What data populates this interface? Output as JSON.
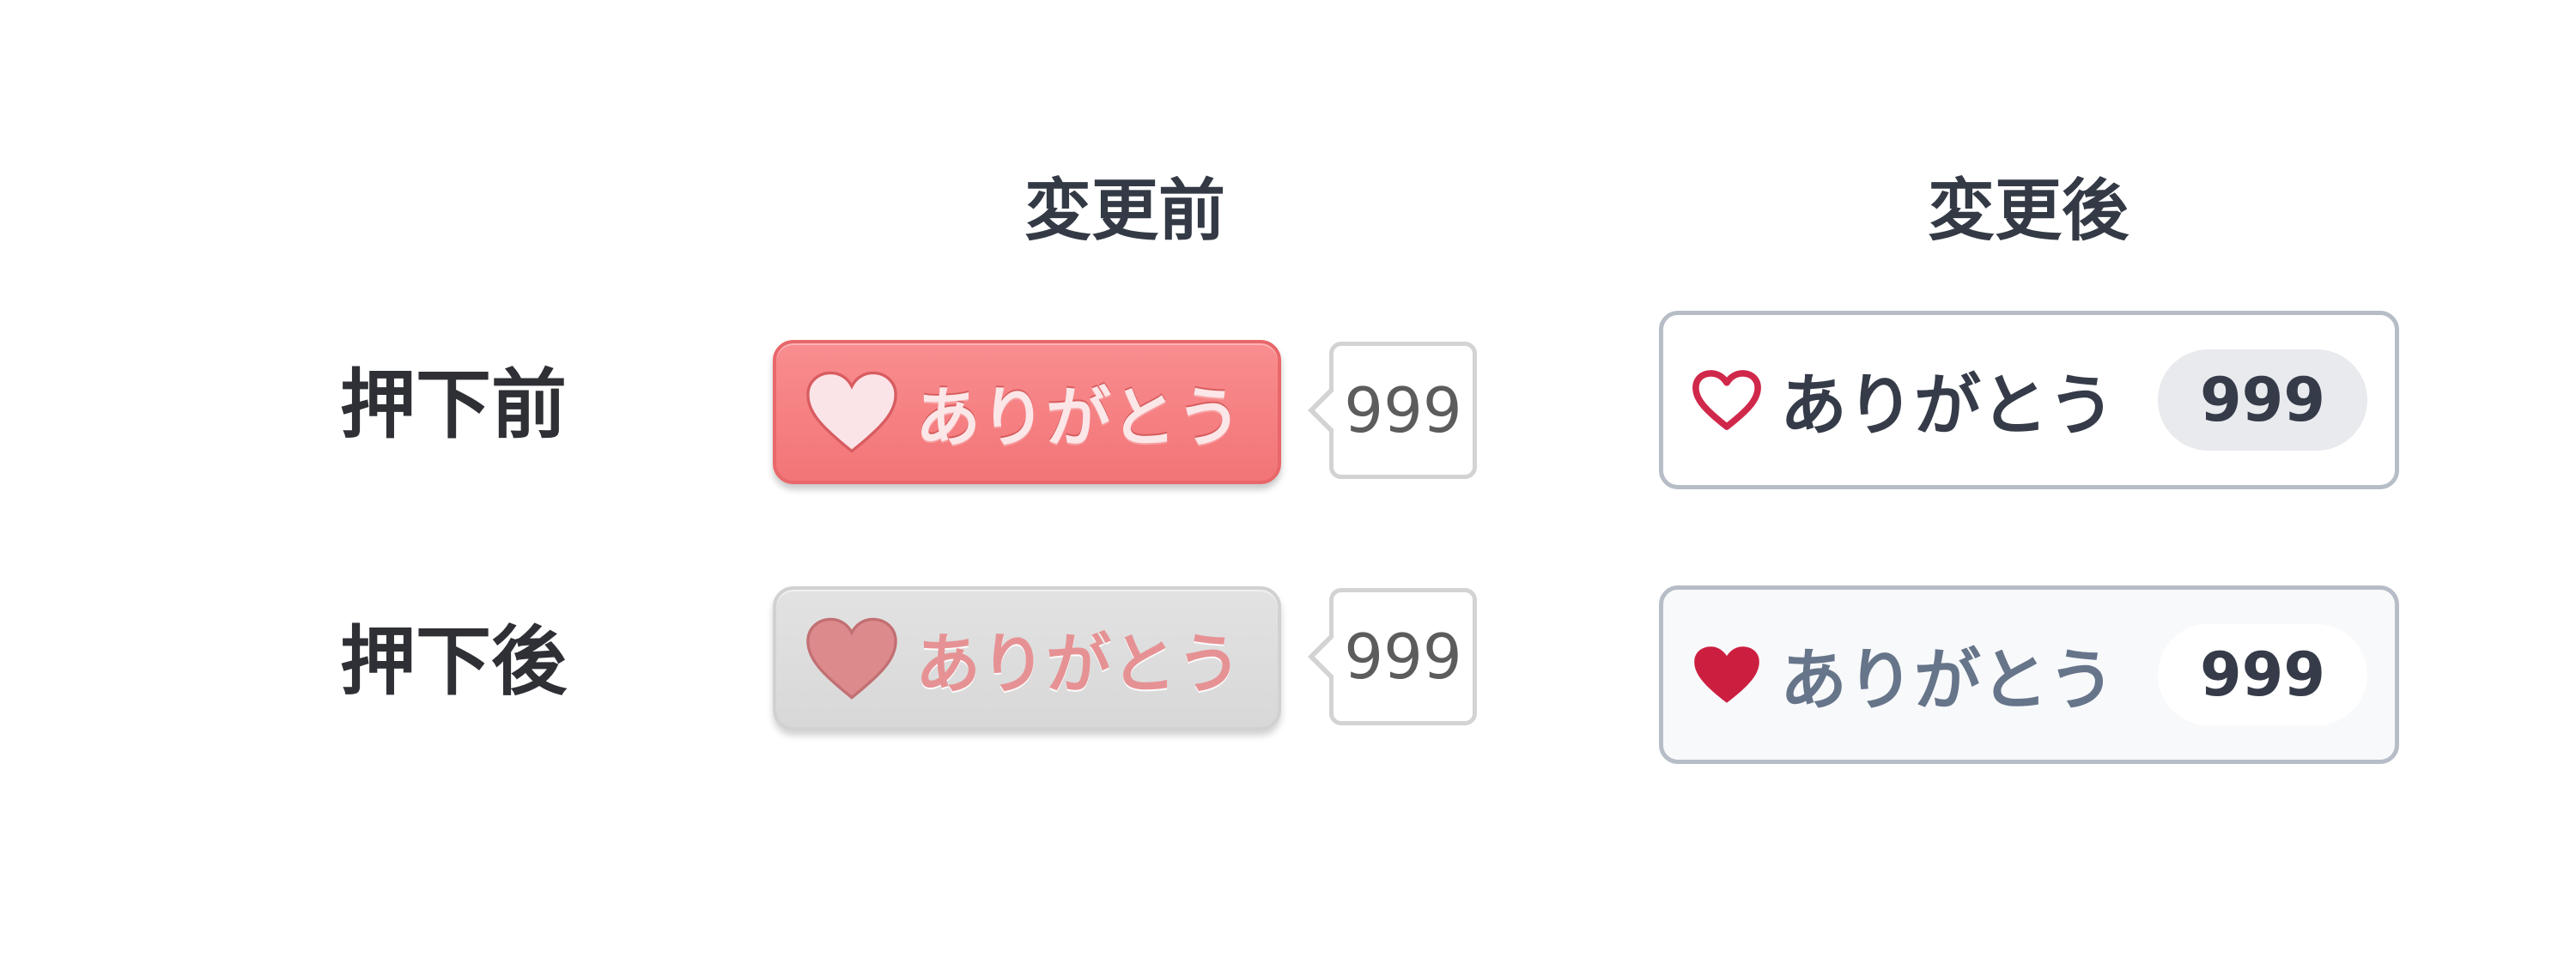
{
  "columns": {
    "before_change": "変更前",
    "after_change": "変更後"
  },
  "rows": {
    "before_press": "押下前",
    "after_press": "押下後"
  },
  "old_style": {
    "unpressed": {
      "label": "ありがとう",
      "count": "999"
    },
    "pressed": {
      "label": "ありがとう",
      "count": "999"
    }
  },
  "new_style": {
    "unpressed": {
      "label": "ありがとう",
      "count": "999"
    },
    "pressed": {
      "label": "ありがとう",
      "count": "999"
    }
  },
  "colors": {
    "old_active_bg": "#f27577",
    "old_pressed_bg": "#dddddd",
    "new_heart_outline": "#d0284a",
    "new_heart_filled": "#cc1f40",
    "new_border": "#b7bdc7"
  },
  "icons": {
    "old_heart": "heart-icon",
    "new_heart_outline": "heart-outline-icon",
    "new_heart_filled": "heart-filled-icon"
  }
}
